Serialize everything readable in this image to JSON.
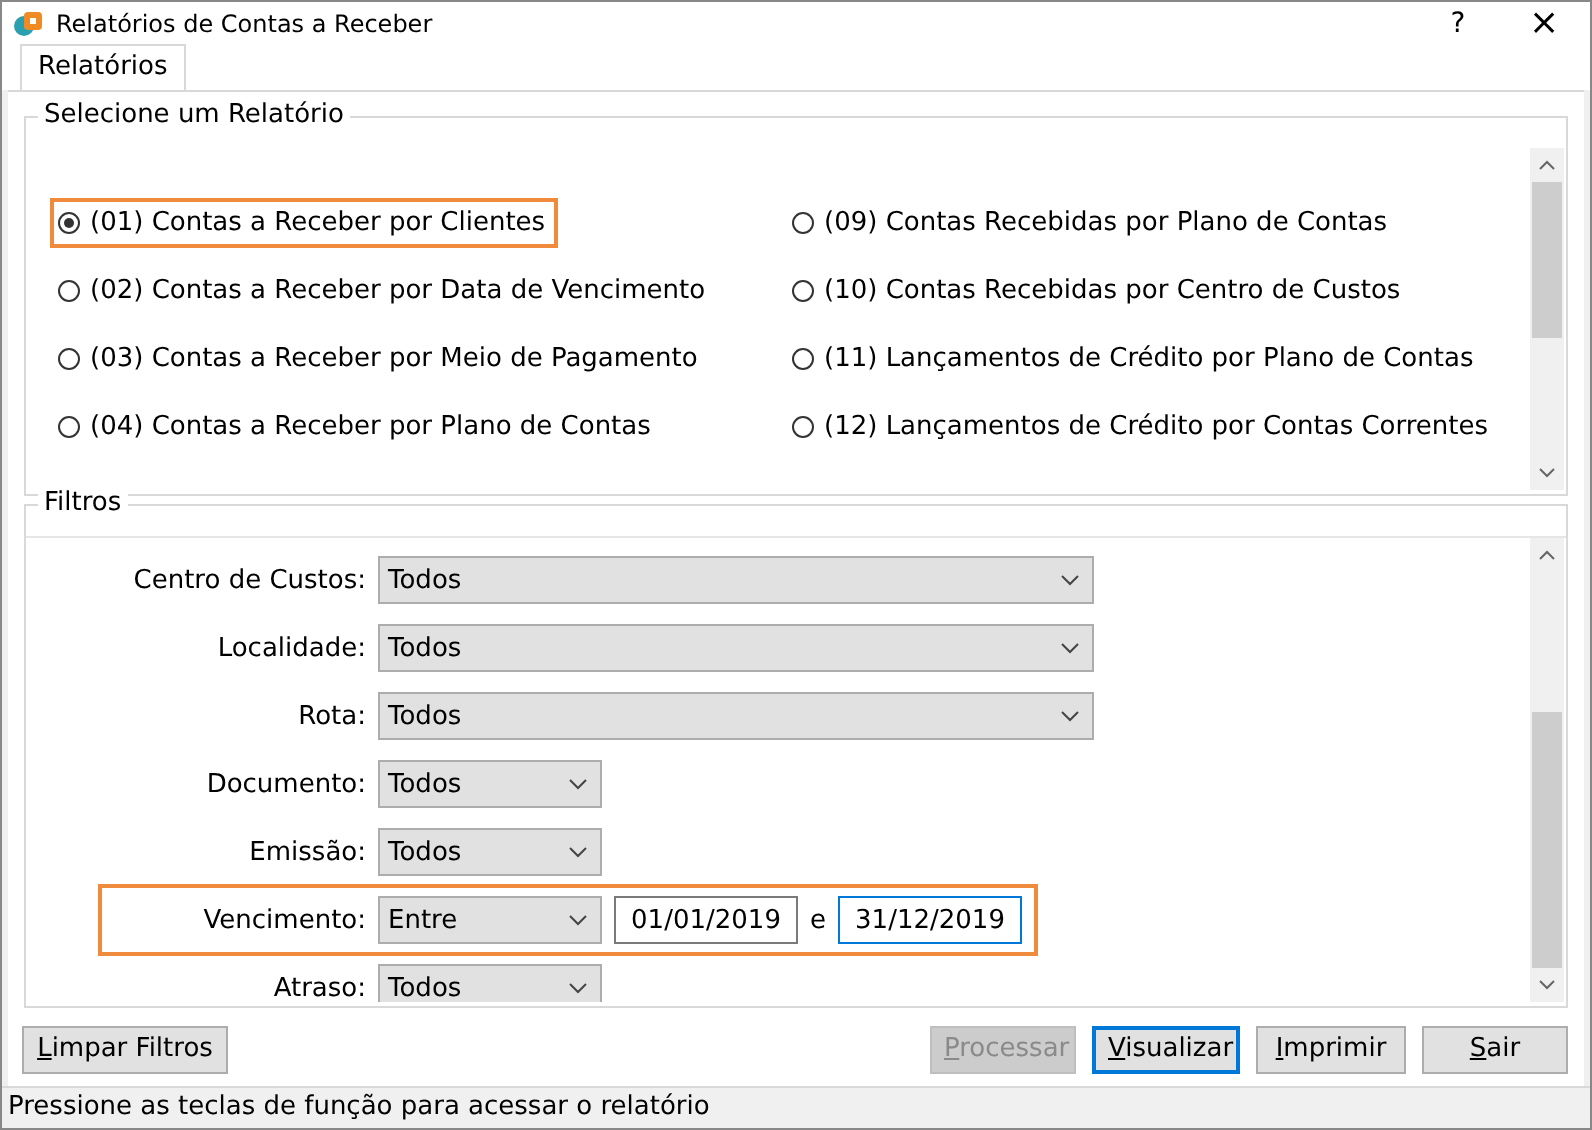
{
  "window": {
    "title": "Relatórios de Contas a Receber",
    "help": "?",
    "close": "×"
  },
  "tabs": [
    {
      "label": "Relatórios",
      "selected": true
    }
  ],
  "reports": {
    "title": "Selecione um Relatório",
    "items": [
      {
        "label": "(01) Contas a Receber por Clientes",
        "selected": true,
        "highlighted": true
      },
      {
        "label": "(09) Contas Recebidas por Plano de Contas",
        "selected": false,
        "highlighted": false
      },
      {
        "label": "(02) Contas a Receber por Data de Vencimento",
        "selected": false,
        "highlighted": false
      },
      {
        "label": "(10) Contas Recebidas por Centro de Custos",
        "selected": false,
        "highlighted": false
      },
      {
        "label": "(03) Contas a Receber por Meio de Pagamento",
        "selected": false,
        "highlighted": false
      },
      {
        "label": "(11) Lançamentos de Crédito por Plano de Contas",
        "selected": false,
        "highlighted": false
      },
      {
        "label": "(04) Contas a Receber por Plano de Contas",
        "selected": false,
        "highlighted": false
      },
      {
        "label": "(12) Lançamentos de Crédito por Contas Correntes",
        "selected": false,
        "highlighted": false
      }
    ]
  },
  "filters": {
    "title": "Filtros",
    "rows": [
      {
        "label": "Centro de Custos:",
        "kind": "long_select",
        "value": "Todos"
      },
      {
        "label": "Localidade:",
        "kind": "long_select",
        "value": "Todos"
      },
      {
        "label": "Rota:",
        "kind": "long_select",
        "value": "Todos"
      },
      {
        "label": "Documento:",
        "kind": "short_select",
        "value": "Todos"
      },
      {
        "label": "Emissão:",
        "kind": "short_select",
        "value": "Todos"
      },
      {
        "label": "Vencimento:",
        "kind": "range",
        "value": "Entre",
        "highlighted": true,
        "from": {
          "value": "01/01/2019",
          "focused": false
        },
        "joiner": "e",
        "to": {
          "value": "31/12/2019",
          "focused": true
        }
      },
      {
        "label": "Atraso:",
        "kind": "short_select",
        "value": "Todos"
      }
    ]
  },
  "buttons": [
    {
      "label": "Limpar Filtros",
      "disabled": false,
      "focused": false
    },
    {
      "label": "Processar",
      "disabled": true,
      "focused": false
    },
    {
      "label": "Visualizar",
      "disabled": false,
      "focused": true
    },
    {
      "label": "Imprimir",
      "disabled": false,
      "focused": false
    },
    {
      "label": "Sair",
      "disabled": false,
      "focused": false
    }
  ],
  "status_bar": "Pressione as teclas de função para acessar o relatório"
}
